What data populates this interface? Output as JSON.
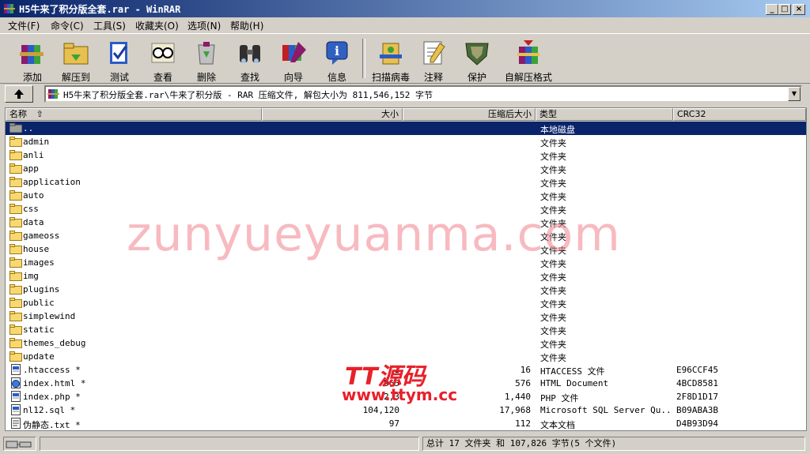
{
  "window": {
    "title": "H5牛来了积分版全套.rar - WinRAR"
  },
  "menu": [
    {
      "label": "文件(F)"
    },
    {
      "label": "命令(C)"
    },
    {
      "label": "工具(S)"
    },
    {
      "label": "收藏夹(O)"
    },
    {
      "label": "选项(N)"
    },
    {
      "label": "帮助(H)"
    }
  ],
  "toolbar": [
    {
      "label": "添加",
      "icon": "books-add-icon"
    },
    {
      "label": "解压到",
      "icon": "folder-extract-icon"
    },
    {
      "label": "测试",
      "icon": "test-check-icon"
    },
    {
      "label": "查看",
      "icon": "glasses-view-icon"
    },
    {
      "label": "删除",
      "icon": "recycle-delete-icon"
    },
    {
      "label": "查找",
      "icon": "binoculars-find-icon"
    },
    {
      "label": "向导",
      "icon": "wizard-icon"
    },
    {
      "label": "信息",
      "icon": "info-icon"
    },
    {
      "label": "扫描病毒",
      "icon": "virus-scan-icon"
    },
    {
      "label": "注释",
      "icon": "comment-icon"
    },
    {
      "label": "保护",
      "icon": "shield-protect-icon"
    },
    {
      "label": "自解压格式",
      "icon": "sfx-icon"
    }
  ],
  "path": {
    "text": "H5牛来了积分版全套.rar\\牛来了积分版 - RAR 压缩文件, 解包大小为 811,546,152 字节"
  },
  "columns": {
    "name": "名称",
    "size": "大小",
    "packed": "压缩后大小",
    "type": "类型",
    "crc": "CRC32"
  },
  "files": [
    {
      "name": "..",
      "size": "",
      "packed": "",
      "type": "本地磁盘",
      "crc": "",
      "kind": "parent",
      "selected": true
    },
    {
      "name": "admin",
      "size": "",
      "packed": "",
      "type": "文件夹",
      "crc": "",
      "kind": "folder"
    },
    {
      "name": "anli",
      "size": "",
      "packed": "",
      "type": "文件夹",
      "crc": "",
      "kind": "folder"
    },
    {
      "name": "app",
      "size": "",
      "packed": "",
      "type": "文件夹",
      "crc": "",
      "kind": "folder"
    },
    {
      "name": "application",
      "size": "",
      "packed": "",
      "type": "文件夹",
      "crc": "",
      "kind": "folder"
    },
    {
      "name": "auto",
      "size": "",
      "packed": "",
      "type": "文件夹",
      "crc": "",
      "kind": "folder"
    },
    {
      "name": "css",
      "size": "",
      "packed": "",
      "type": "文件夹",
      "crc": "",
      "kind": "folder"
    },
    {
      "name": "data",
      "size": "",
      "packed": "",
      "type": "文件夹",
      "crc": "",
      "kind": "folder"
    },
    {
      "name": "gameoss",
      "size": "",
      "packed": "",
      "type": "文件夹",
      "crc": "",
      "kind": "folder"
    },
    {
      "name": "house",
      "size": "",
      "packed": "",
      "type": "文件夹",
      "crc": "",
      "kind": "folder"
    },
    {
      "name": "images",
      "size": "",
      "packed": "",
      "type": "文件夹",
      "crc": "",
      "kind": "folder"
    },
    {
      "name": "img",
      "size": "",
      "packed": "",
      "type": "文件夹",
      "crc": "",
      "kind": "folder"
    },
    {
      "name": "plugins",
      "size": "",
      "packed": "",
      "type": "文件夹",
      "crc": "",
      "kind": "folder"
    },
    {
      "name": "public",
      "size": "",
      "packed": "",
      "type": "文件夹",
      "crc": "",
      "kind": "folder"
    },
    {
      "name": "simplewind",
      "size": "",
      "packed": "",
      "type": "文件夹",
      "crc": "",
      "kind": "folder"
    },
    {
      "name": "static",
      "size": "",
      "packed": "",
      "type": "文件夹",
      "crc": "",
      "kind": "folder"
    },
    {
      "name": "themes_debug",
      "size": "",
      "packed": "",
      "type": "文件夹",
      "crc": "",
      "kind": "folder"
    },
    {
      "name": "update",
      "size": "",
      "packed": "",
      "type": "文件夹",
      "crc": "",
      "kind": "folder"
    },
    {
      "name": ".htaccess *",
      "size": "1",
      "packed": "16",
      "type": "HTACCESS 文件",
      "crc": "E96CCF45",
      "kind": "file"
    },
    {
      "name": "index.html *",
      "size": "965",
      "packed": "576",
      "type": "HTML Document",
      "crc": "4BCD8581",
      "kind": "html"
    },
    {
      "name": "index.php *",
      "size": "2,3",
      "packed": "1,440",
      "type": "PHP 文件",
      "crc": "2F8D1D17",
      "kind": "file"
    },
    {
      "name": "nl12.sql *",
      "size": "104,120",
      "packed": "17,968",
      "type": "Microsoft SQL Server Qu...",
      "crc": "B09ABA3B",
      "kind": "file"
    },
    {
      "name": "伪静态.txt *",
      "size": "97",
      "packed": "112",
      "type": "文本文档",
      "crc": "D4B93D94",
      "kind": "text"
    }
  ],
  "status": {
    "left": "",
    "right": "总计 17 文件夹 和 107,826 字节(5 个文件)"
  },
  "watermark": {
    "text": "zunyueyuanma.com",
    "logo_top": "TT源码",
    "logo_bottom": "www.ttym.cc"
  },
  "colors": {
    "titlebar_start": "#0a246a",
    "titlebar_end": "#a6caf0",
    "selection": "#0a246a",
    "watermark": "#f0828c",
    "logo": "#e8202a"
  }
}
